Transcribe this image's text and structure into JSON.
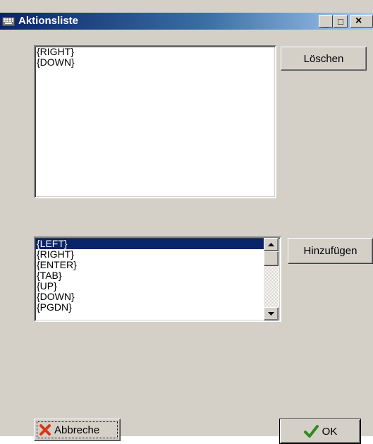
{
  "window": {
    "title": "Aktionsliste",
    "controls": {
      "minimize": "_",
      "maximize": "□",
      "close": "×"
    }
  },
  "action_list": {
    "items": [
      "{RIGHT}",
      "{DOWN}"
    ]
  },
  "available_list": {
    "items": [
      "{LEFT}",
      "{RIGHT}",
      "{ENTER}",
      "{TAB}",
      "{UP}",
      "{DOWN}",
      "{PGDN}"
    ],
    "selected": "{LEFT}"
  },
  "buttons": {
    "delete_label": "Löschen",
    "add_label": "Hinzufügen",
    "cancel_label": "Abbreche",
    "ok_label": "OK"
  },
  "icons": {
    "cancel": "x-mark-icon",
    "ok": "checkmark-icon",
    "app": "keyboard-icon",
    "cancel_color": "#d9361b",
    "ok_color": "#2e8b1e"
  },
  "colors": {
    "titlebar_start": "#0a246a",
    "titlebar_end": "#a6caf0",
    "selection": "#0a246a",
    "face": "#d4d0c8"
  }
}
